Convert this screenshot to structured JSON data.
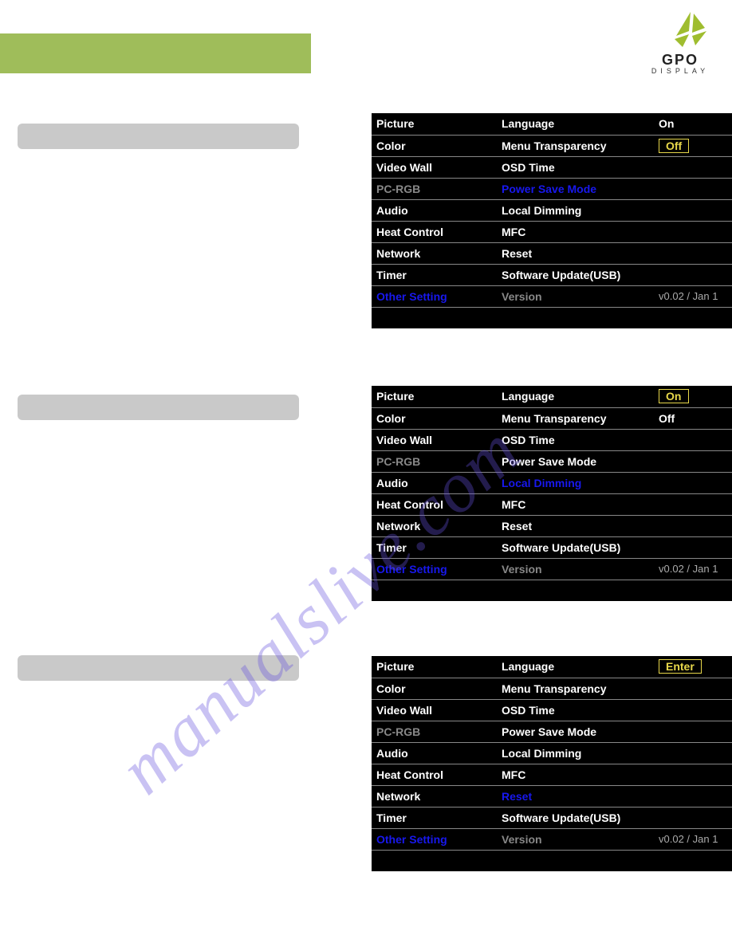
{
  "logo": {
    "name": "GPO",
    "sub": "DISPLAY"
  },
  "watermark": "manualslive.com",
  "sections": [
    {
      "top_label": 155,
      "top_table": 142,
      "highlight_left": null,
      "highlight_right": "Power Save Mode",
      "values": [
        {
          "text": "On",
          "boxed": false
        },
        {
          "text": "Off",
          "boxed": true
        }
      ],
      "version": "v0.02 / Jan 1"
    },
    {
      "top_label": 495,
      "top_table": 484,
      "highlight_left": null,
      "highlight_right": "Local Dimming",
      "values": [
        {
          "text": "On",
          "boxed": true
        },
        {
          "text": "Off",
          "boxed": false
        }
      ],
      "version": "v0.02 / Jan 1"
    },
    {
      "top_label": 822,
      "top_table": 823,
      "highlight_left": null,
      "highlight_right": "Reset",
      "values": [
        {
          "text": "Enter",
          "boxed": true
        }
      ],
      "version": "v0.02 / Jan 1"
    }
  ],
  "menu_left": [
    "Picture",
    "Color",
    "Video Wall",
    "PC-RGB",
    "Audio",
    "Heat Control",
    "Network",
    "Timer",
    "Other Setting"
  ],
  "menu_right": [
    "Language",
    "Menu Transparency",
    "OSD Time",
    "Power Save Mode",
    "Local Dimming",
    "MFC",
    "Reset",
    "Software Update(USB)",
    "Version"
  ]
}
